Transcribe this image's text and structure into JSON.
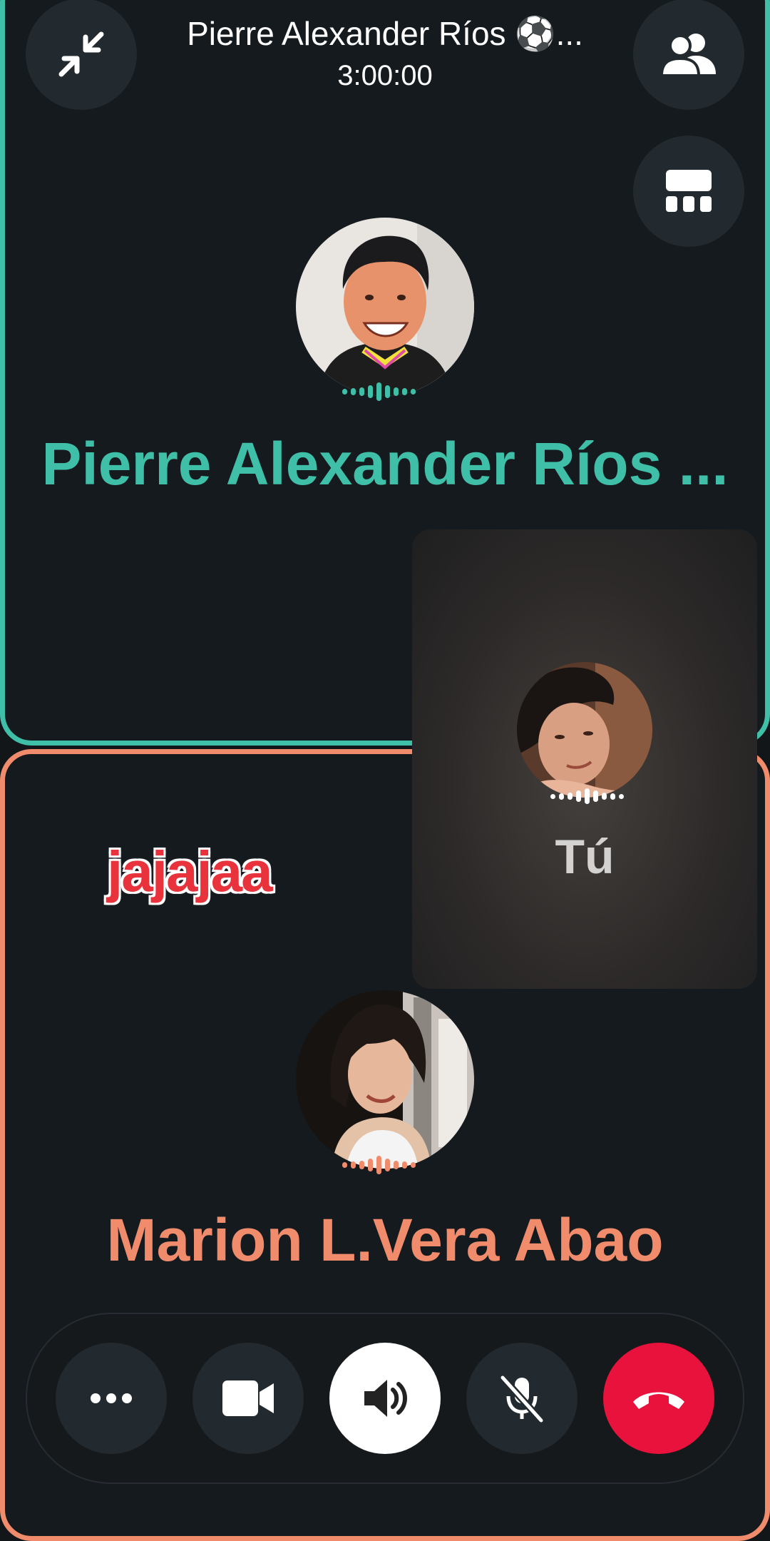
{
  "header": {
    "title": "Pierre Alexander Ríos ⚽...",
    "timer": "3:00:00"
  },
  "participants": {
    "top": {
      "name": "Pierre Alexander Ríos ...",
      "color": "#3fbfa8"
    },
    "self": {
      "name": "Tú"
    },
    "bottom": {
      "name": "Marion L.Vera Abao",
      "color": "#f08c6c"
    }
  },
  "sticker": {
    "text": "jajajaa"
  },
  "icons": {
    "minimize": "minimize-arrows-icon",
    "participants": "participants-icon",
    "layout": "layout-grid-icon",
    "more": "more-dots-icon",
    "video": "video-camera-icon",
    "speaker": "speaker-icon",
    "mic": "mic-muted-icon",
    "end": "end-call-icon"
  },
  "colors": {
    "end_call": "#e8123c",
    "speaker_bg": "#ffffff"
  }
}
